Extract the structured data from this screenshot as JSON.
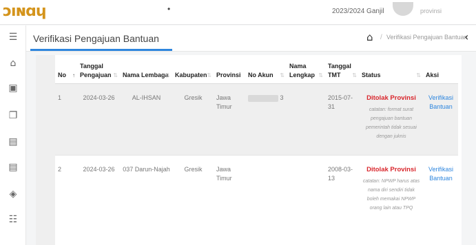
{
  "topbar": {
    "logo": "ɔıɴɑɥ",
    "dot": "•",
    "year": "2023/2024 Ganjil",
    "role": "provinsi"
  },
  "sidebar": {
    "items": [
      {
        "icon": "menu-icon",
        "glyph": "☰"
      },
      {
        "icon": "home-icon",
        "glyph": "⌂"
      },
      {
        "icon": "calendar-icon",
        "glyph": "▣"
      },
      {
        "icon": "files-icon",
        "glyph": "❐"
      },
      {
        "icon": "list-icon",
        "glyph": "▤"
      },
      {
        "icon": "list-icon",
        "glyph": "▤"
      },
      {
        "icon": "tag-icon",
        "glyph": "◈"
      },
      {
        "icon": "bullets-icon",
        "glyph": "☷"
      }
    ]
  },
  "page": {
    "title": "Verifikasi Pengajuan Bantuan",
    "breadcrumb_home": "⌂",
    "breadcrumb_sep": "/",
    "breadcrumb_text": "Verifikasi Pengajuan Bantuan",
    "collapse": "‹"
  },
  "table": {
    "headers": {
      "no": "No",
      "tanggal": "Tanggal Pengajuan",
      "nama_lembaga": "Nama Lembaga",
      "kabupaten": "Kabupaten",
      "provinsi": "Provinsi",
      "no_akun": "No Akun",
      "nama_lengkap": "Nama Lengkap",
      "tmt": "Tanggal TMT",
      "status": "Status",
      "aksi": "Aksi"
    },
    "sort_icon": "⇅",
    "sort_active": "↑",
    "rows": [
      {
        "no": "1",
        "tanggal": "2024-03-26",
        "lembaga": "AL-IHSAN",
        "kabupaten": "Gresik",
        "provinsi": "Jawa Timur",
        "akun_suffix": "3",
        "nama_lengkap": "",
        "tmt": "2015-07-31",
        "status": "Ditolak Provinsi",
        "catatan": "catatan: format surat pengajuan bantuan pemerintah tidak sesuai dengan juknis",
        "aksi": "Verifikasi Bantuan"
      },
      {
        "no": "2",
        "tanggal": "2024-03-26",
        "lembaga": "037 Darun-Najah",
        "kabupaten": "Gresik",
        "provinsi": "Jawa Timur",
        "akun_suffix": "",
        "nama_lengkap": "",
        "tmt": "2008-03-13",
        "status": "Ditolak Provinsi",
        "catatan": "catatan: NPWP harus atas nama diri sendiri tidak boleh memakai NPWP orang lain atau TPQ",
        "aksi": "Verifikasi Bantuan"
      }
    ]
  },
  "colors": {
    "accent": "#2e86de",
    "danger": "#d9262c",
    "logo": "#d4941c"
  }
}
